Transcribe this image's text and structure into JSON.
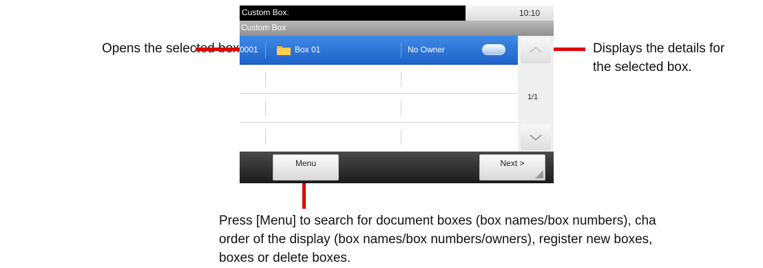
{
  "screen": {
    "title": "Custom Box.",
    "clock": "10:10",
    "subtitle": "Custom Box",
    "rows": [
      {
        "number": "0001",
        "name": "Box 01",
        "owner": "No Owner"
      }
    ],
    "page_indicator": "1/1",
    "menu_label": "Menu",
    "next_label": "Next >"
  },
  "annotations": {
    "left": "Opens the selected box.",
    "right_line1": "Displays the details for",
    "right_line2": "the selected box.",
    "bottom_line1": "Press [Menu] to search for document boxes (box names/box numbers), cha",
    "bottom_line2": "order of the display (box names/box numbers/owners), register new boxes,",
    "bottom_line3": "boxes or delete boxes."
  },
  "colors": {
    "callout": "#e00000",
    "selected_row": "#2a72d6"
  },
  "icons": {
    "folder": "folder-icon",
    "details": "details-button",
    "scroll_up": "chevron-up-icon",
    "scroll_down": "chevron-down-icon"
  }
}
